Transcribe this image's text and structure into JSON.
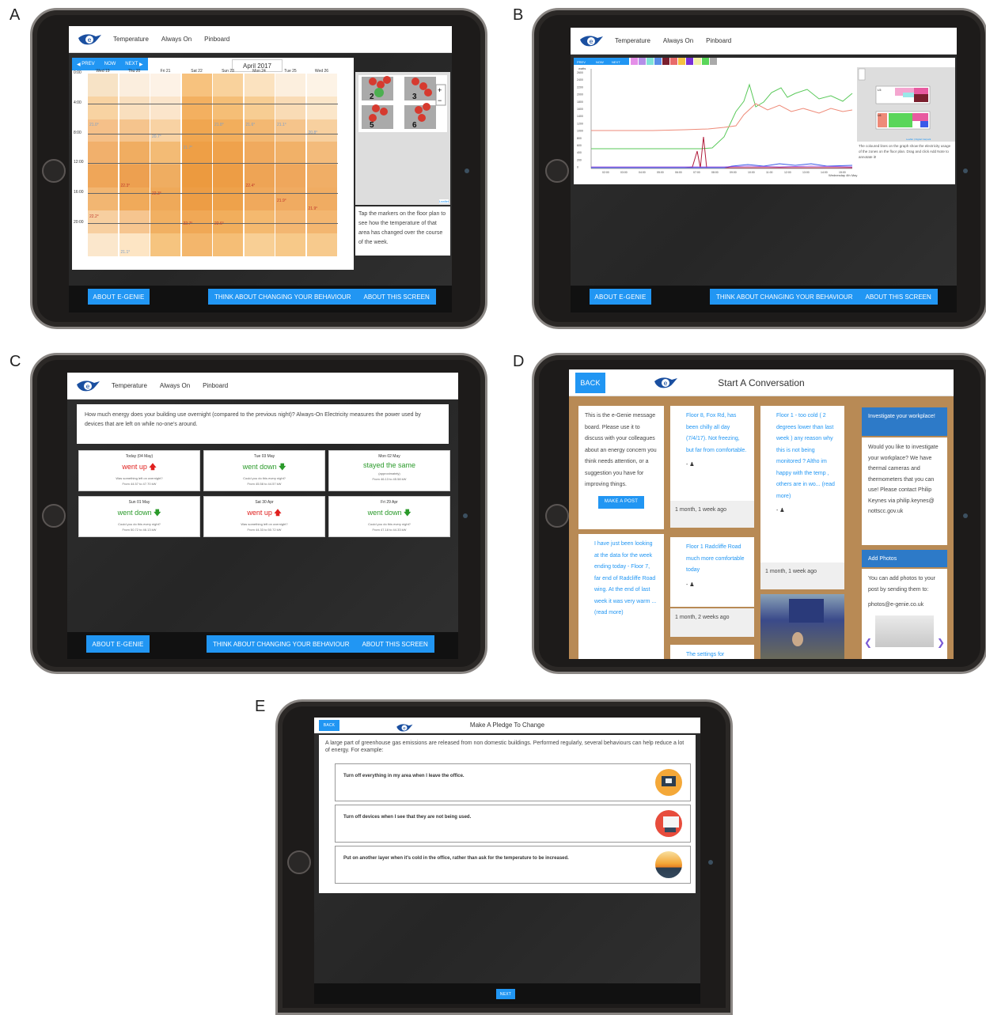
{
  "panel_letters": [
    "A",
    "B",
    "C",
    "D",
    "E"
  ],
  "nav": {
    "temperature": "Temperature",
    "always_on": "Always On",
    "pinboard": "Pinboard"
  },
  "buttons": {
    "about": "ABOUT E-GENIE",
    "think": "THINK ABOUT CHANGING YOUR BEHAVIOUR",
    "about_screen": "ABOUT THIS SCREEN",
    "back": "BACK",
    "next": "NEXT",
    "make_post": "MAKE A POST"
  },
  "panelA": {
    "prev": "PREV",
    "now": "NOW",
    "next": "NEXT",
    "month": "April 2017",
    "days": [
      "Wed 19",
      "Thu 20",
      "Fri 21",
      "Sat 22",
      "Sun 23",
      "Mon 24",
      "Tue 25",
      "Wed 26"
    ],
    "hours": [
      "0:00",
      "4:00",
      "8:00",
      "12:00",
      "16:00",
      "20:00"
    ],
    "temps": [
      "21.0°",
      "20.7°",
      "21.7°",
      "21.8°",
      "21.6°",
      "21.1°",
      "20.8°",
      "22.3°",
      "22.3°",
      "22.4°",
      "21.9°",
      "21.9°",
      "22.2°",
      "22.7°",
      "22.6°",
      "21.1°"
    ],
    "zones": [
      "2",
      "3",
      "5",
      "6"
    ],
    "zoom_in": "+",
    "zoom_out": "−",
    "leaflet": "Leaflet",
    "info": "Tap the markers on the floor plan to see how the temperature of that area has changed over the course of the week."
  },
  "panelB": {
    "nav_prev": "PREV",
    "nav_now": "NOW",
    "nav_next": "NEXT",
    "ylabel": "watts",
    "yticks": [
      "2600",
      "2400",
      "2200",
      "2000",
      "1800",
      "1600",
      "1400",
      "1200",
      "1000",
      "800",
      "600",
      "400",
      "200",
      "0"
    ],
    "xticks": [
      "02:00",
      "03:00",
      "04:00",
      "05:00",
      "06:00",
      "07:00",
      "08:00",
      "09:00",
      "10:00",
      "11:00",
      "12:00",
      "13:00",
      "14:00",
      "15:00"
    ],
    "date": "Wednesday 4th May",
    "zone_labels": [
      "L5",
      "L6"
    ],
    "leaflet": "Leaflet | Digital Carpark",
    "info": "The coloured lines on the graph show the electricity usage of the zones on the floor plan. Drag and click Add Note to annotate it!"
  },
  "panelC": {
    "question": "How much energy does your building use overnight (compared to the previous night)? Always-On Electricity measures the power used by devices that are left on while no-one's around.",
    "cards": [
      {
        "date": "Today (04 May)",
        "status": "went up",
        "dir": "up",
        "sub": "Was something left on overnight?",
        "range": "From 44.57 to 47.70 kW"
      },
      {
        "date": "Tue 03 May",
        "status": "went down",
        "dir": "down",
        "sub": "Could you do this every night?",
        "range": "From 45.58 to 44.57 kW"
      },
      {
        "date": "Mon 02 May",
        "status": "stayed the same",
        "dir": "same",
        "sub": "(approximately)",
        "range": "From 46.13 to 45.58 kW"
      },
      {
        "date": "Sun 01 May",
        "status": "went down",
        "dir": "down",
        "sub": "Could you do this every night?",
        "range": "From 50.72 to 46.13 kW"
      },
      {
        "date": "Sat 30 Apr",
        "status": "went up",
        "dir": "up",
        "sub": "Was something left on overnight?",
        "range": "From 44.33 to 50.72 kW"
      },
      {
        "date": "Fri 29 Apr",
        "status": "went down",
        "dir": "down",
        "sub": "Could you do this every night?",
        "range": "From 47.18 to 44.33 kW"
      }
    ]
  },
  "panelD": {
    "title": "Start A Conversation",
    "intro": "This is the e-Genie message board. Please use it to discuss with your colleagues about an energy concern you think needs attention, or a suggestion you have for improving things.",
    "post1": "I have just been looking at the data for the week ending today - Floor 7, far end of Radcliffe Road wing. At the end of last week it was very warm ... (read more)",
    "post2": "Floor 8, Fox Rd, has been chilly all day (7/4/17). Not freezing, but far from comfortable.",
    "post2_time": "1 month, 1 week ago",
    "post3": "Floor 1 Radcliffe Road much more comfortable today",
    "post3_time": "1 month, 2 weeks ago",
    "post4": "The settings for",
    "post5": "Floor 1 - too cold ( 2 degrees lower than last week ) any reason why this is not being monitored ? Altho im happy with the temp , others are in wo... (read more)",
    "post5_time": "1 month, 1 week ago",
    "author": "-",
    "side1_head": "Investigate your workplace!",
    "side1_body": "Would you like to investigate your workplace? We have thermal cameras and thermometers that you can use! Please contact Philip Keynes via philip.keynes@ nottscc.gov.uk",
    "side2_head": "Add Photos",
    "side2_body": "You can add photos to your post by sending them to:",
    "side2_email": "photos@e-genie.co.uk"
  },
  "panelE": {
    "title": "Make A Pledge To Change",
    "intro": "A large part of greenhouse gas emissions are released from non domestic buildings. Performed regularly, several behaviours can help reduce a lot of energy. For example:",
    "pledges": [
      "Turn off everything in my area when I leave the office.",
      "Turn off devices when I see that they are not being used.",
      "Put on another layer when it's cold in the office, rather than ask for the temperature to be increased."
    ]
  }
}
